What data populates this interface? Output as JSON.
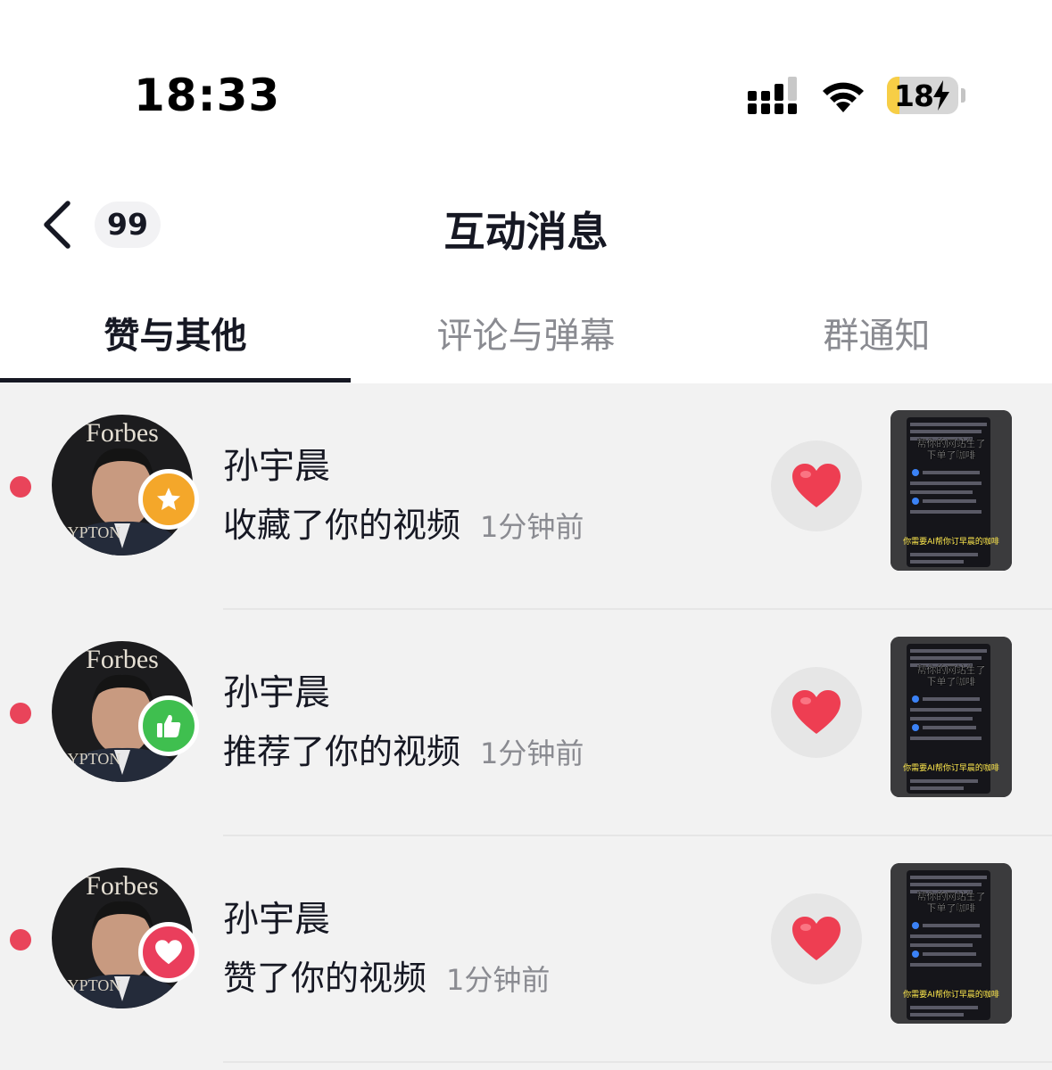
{
  "status_bar": {
    "time": "18:33",
    "battery_level": "18",
    "battery_percent": 18,
    "battery_color": "#f7ce46"
  },
  "nav": {
    "back_icon": "chevron-left-icon",
    "unread_badge": "99",
    "title": "互动消息"
  },
  "tabs": [
    {
      "label": "赞与其他",
      "active": true
    },
    {
      "label": "评论与弹幕",
      "active": false
    },
    {
      "label": "群通知",
      "active": false
    }
  ],
  "notifications": [
    {
      "name": "孙宇晨",
      "action": "收藏了你的视频",
      "time": "1分钟前",
      "badge_icon": "star-icon",
      "badge_color": "#f4a72a",
      "unread": true,
      "like_icon": "heart-icon"
    },
    {
      "name": "孙宇晨",
      "action": "推荐了你的视频",
      "time": "1分钟前",
      "badge_icon": "thumbs-up-icon",
      "badge_color": "#3fbf4f",
      "unread": true,
      "like_icon": "heart-icon"
    },
    {
      "name": "孙宇晨",
      "action": "赞了你的视频",
      "time": "1分钟前",
      "badge_icon": "heart-icon",
      "badge_color": "#ea3e5c",
      "unread": true,
      "like_icon": "heart-icon"
    }
  ],
  "thumbnail": {
    "caption_line1": "帮你的网站生了",
    "caption_line2": "下单了咖啡",
    "caption_line3": "你需要AI帮你订早晨的咖啡"
  },
  "colors": {
    "accent_red": "#e9445a",
    "list_bg": "#f2f2f2"
  }
}
